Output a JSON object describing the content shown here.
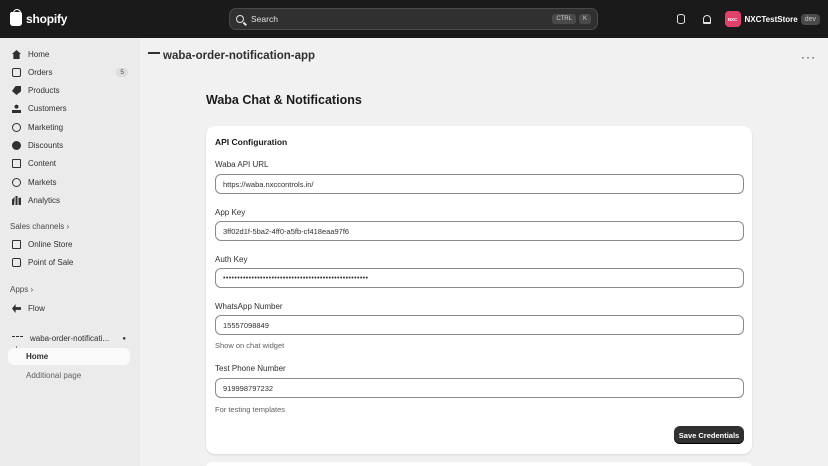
{
  "topbar": {
    "logo_text": "shopify",
    "search_placeholder": "Search",
    "shortcut_keys": [
      "CTRL",
      "K"
    ],
    "avatar_initials": "NXC",
    "store_name": "NXCTestStore",
    "env_badge": "dev"
  },
  "sidebar": {
    "items": [
      {
        "label": "Home",
        "icon": "home-icon"
      },
      {
        "label": "Orders",
        "icon": "orders-icon",
        "count": "5"
      },
      {
        "label": "Products",
        "icon": "tag-icon"
      },
      {
        "label": "Customers",
        "icon": "person-icon"
      },
      {
        "label": "Marketing",
        "icon": "target-icon"
      },
      {
        "label": "Discounts",
        "icon": "discount-icon"
      },
      {
        "label": "Content",
        "icon": "content-icon"
      },
      {
        "label": "Markets",
        "icon": "globe-icon"
      },
      {
        "label": "Analytics",
        "icon": "analytics-icon"
      }
    ],
    "sales_channels_label": "Sales channels",
    "sales_channels": [
      {
        "label": "Online Store",
        "icon": "store-icon"
      },
      {
        "label": "Point of Sale",
        "icon": "pos-icon"
      }
    ],
    "apps_label": "Apps",
    "apps": [
      {
        "label": "Flow",
        "icon": "flow-icon"
      }
    ],
    "current_app": "waba-order-notificati...",
    "app_subitems": [
      "Home",
      "Additional page"
    ]
  },
  "main": {
    "app_name": "waba-order-notification-app",
    "more_label": "···",
    "page_title": "Waba Chat & Notifications",
    "card": {
      "title": "API Configuration",
      "fields": [
        {
          "label": "Waba API URL",
          "value": "https://waba.nxccontrols.in/"
        },
        {
          "label": "App Key",
          "value": "3ff02d1f-5ba2-4ff0-a5fb-cf418eaa97f6"
        },
        {
          "label": "Auth Key",
          "value": "•••••••••••••••••••••••••••••••••••••••••••••••••••"
        },
        {
          "label": "WhatsApp Number",
          "value": "15557098849",
          "help": "Show on chat widget"
        },
        {
          "label": "Test Phone Number",
          "value": "919998797232",
          "help": "For testing templates"
        }
      ],
      "save_label": "Save Credentials"
    }
  }
}
